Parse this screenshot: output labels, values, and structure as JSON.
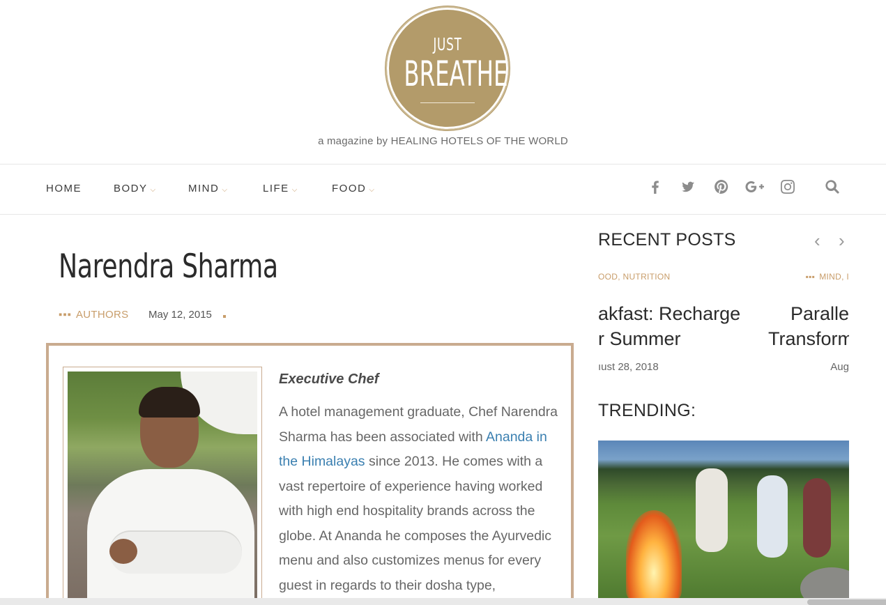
{
  "logo": {
    "line1": "JUST",
    "line2": "BREATHE",
    "alt": "Just Breathe logo"
  },
  "tagline": "a magazine by HEALING HOTELS OF THE WORLD",
  "nav": {
    "items": [
      {
        "label": "HOME",
        "has_dropdown": false
      },
      {
        "label": "BODY",
        "has_dropdown": true
      },
      {
        "label": "MIND",
        "has_dropdown": true
      },
      {
        "label": "LIFE",
        "has_dropdown": true
      },
      {
        "label": "FOOD",
        "has_dropdown": true
      }
    ],
    "caret": "⌵",
    "social_icons": [
      "facebook-icon",
      "twitter-icon",
      "pinterest-icon",
      "google-plus-icon",
      "instagram-icon"
    ],
    "search_icon": "search-icon"
  },
  "article": {
    "title": "Narendra Sharma",
    "category_dots": "▪▪▪",
    "category": "AUTHORS",
    "date": "May 12, 2015",
    "role": "Executive Chef",
    "bio_before_link": "A hotel management graduate, Chef Narendra Sharma has been associated with ",
    "bio_link": "Ananda in the Himalayas",
    "bio_after_link": " since 2013. He comes with a vast repertoire of experience having worked with high end hospitality brands across the globe.  At Ananda he composes the Ayurvedic menu and also customizes menus for every guest in regards to their dosha type,  determined during"
  },
  "sidebar": {
    "recent_posts_title": "RECENT POSTS",
    "prev_arrow": "‹",
    "next_arrow": "›",
    "slides": [
      {
        "cats_visible": "OOD, NUTRITION",
        "title_line1": "akfast: Recharge",
        "title_line2": "r Summer",
        "date": "ıust 28, 2018"
      },
      {
        "cats_dots": "▪▪▪",
        "cats_visible": "MIND, I",
        "title_line1": "Paralle",
        "title_line2": "Transform",
        "date": "Aug"
      }
    ],
    "trending_title": "TRENDING:"
  },
  "colors": {
    "accent": "#c89d6a",
    "logo_gold": "#b39b6a",
    "link": "#3a7fb0",
    "card_border": "#c9ab8f"
  }
}
